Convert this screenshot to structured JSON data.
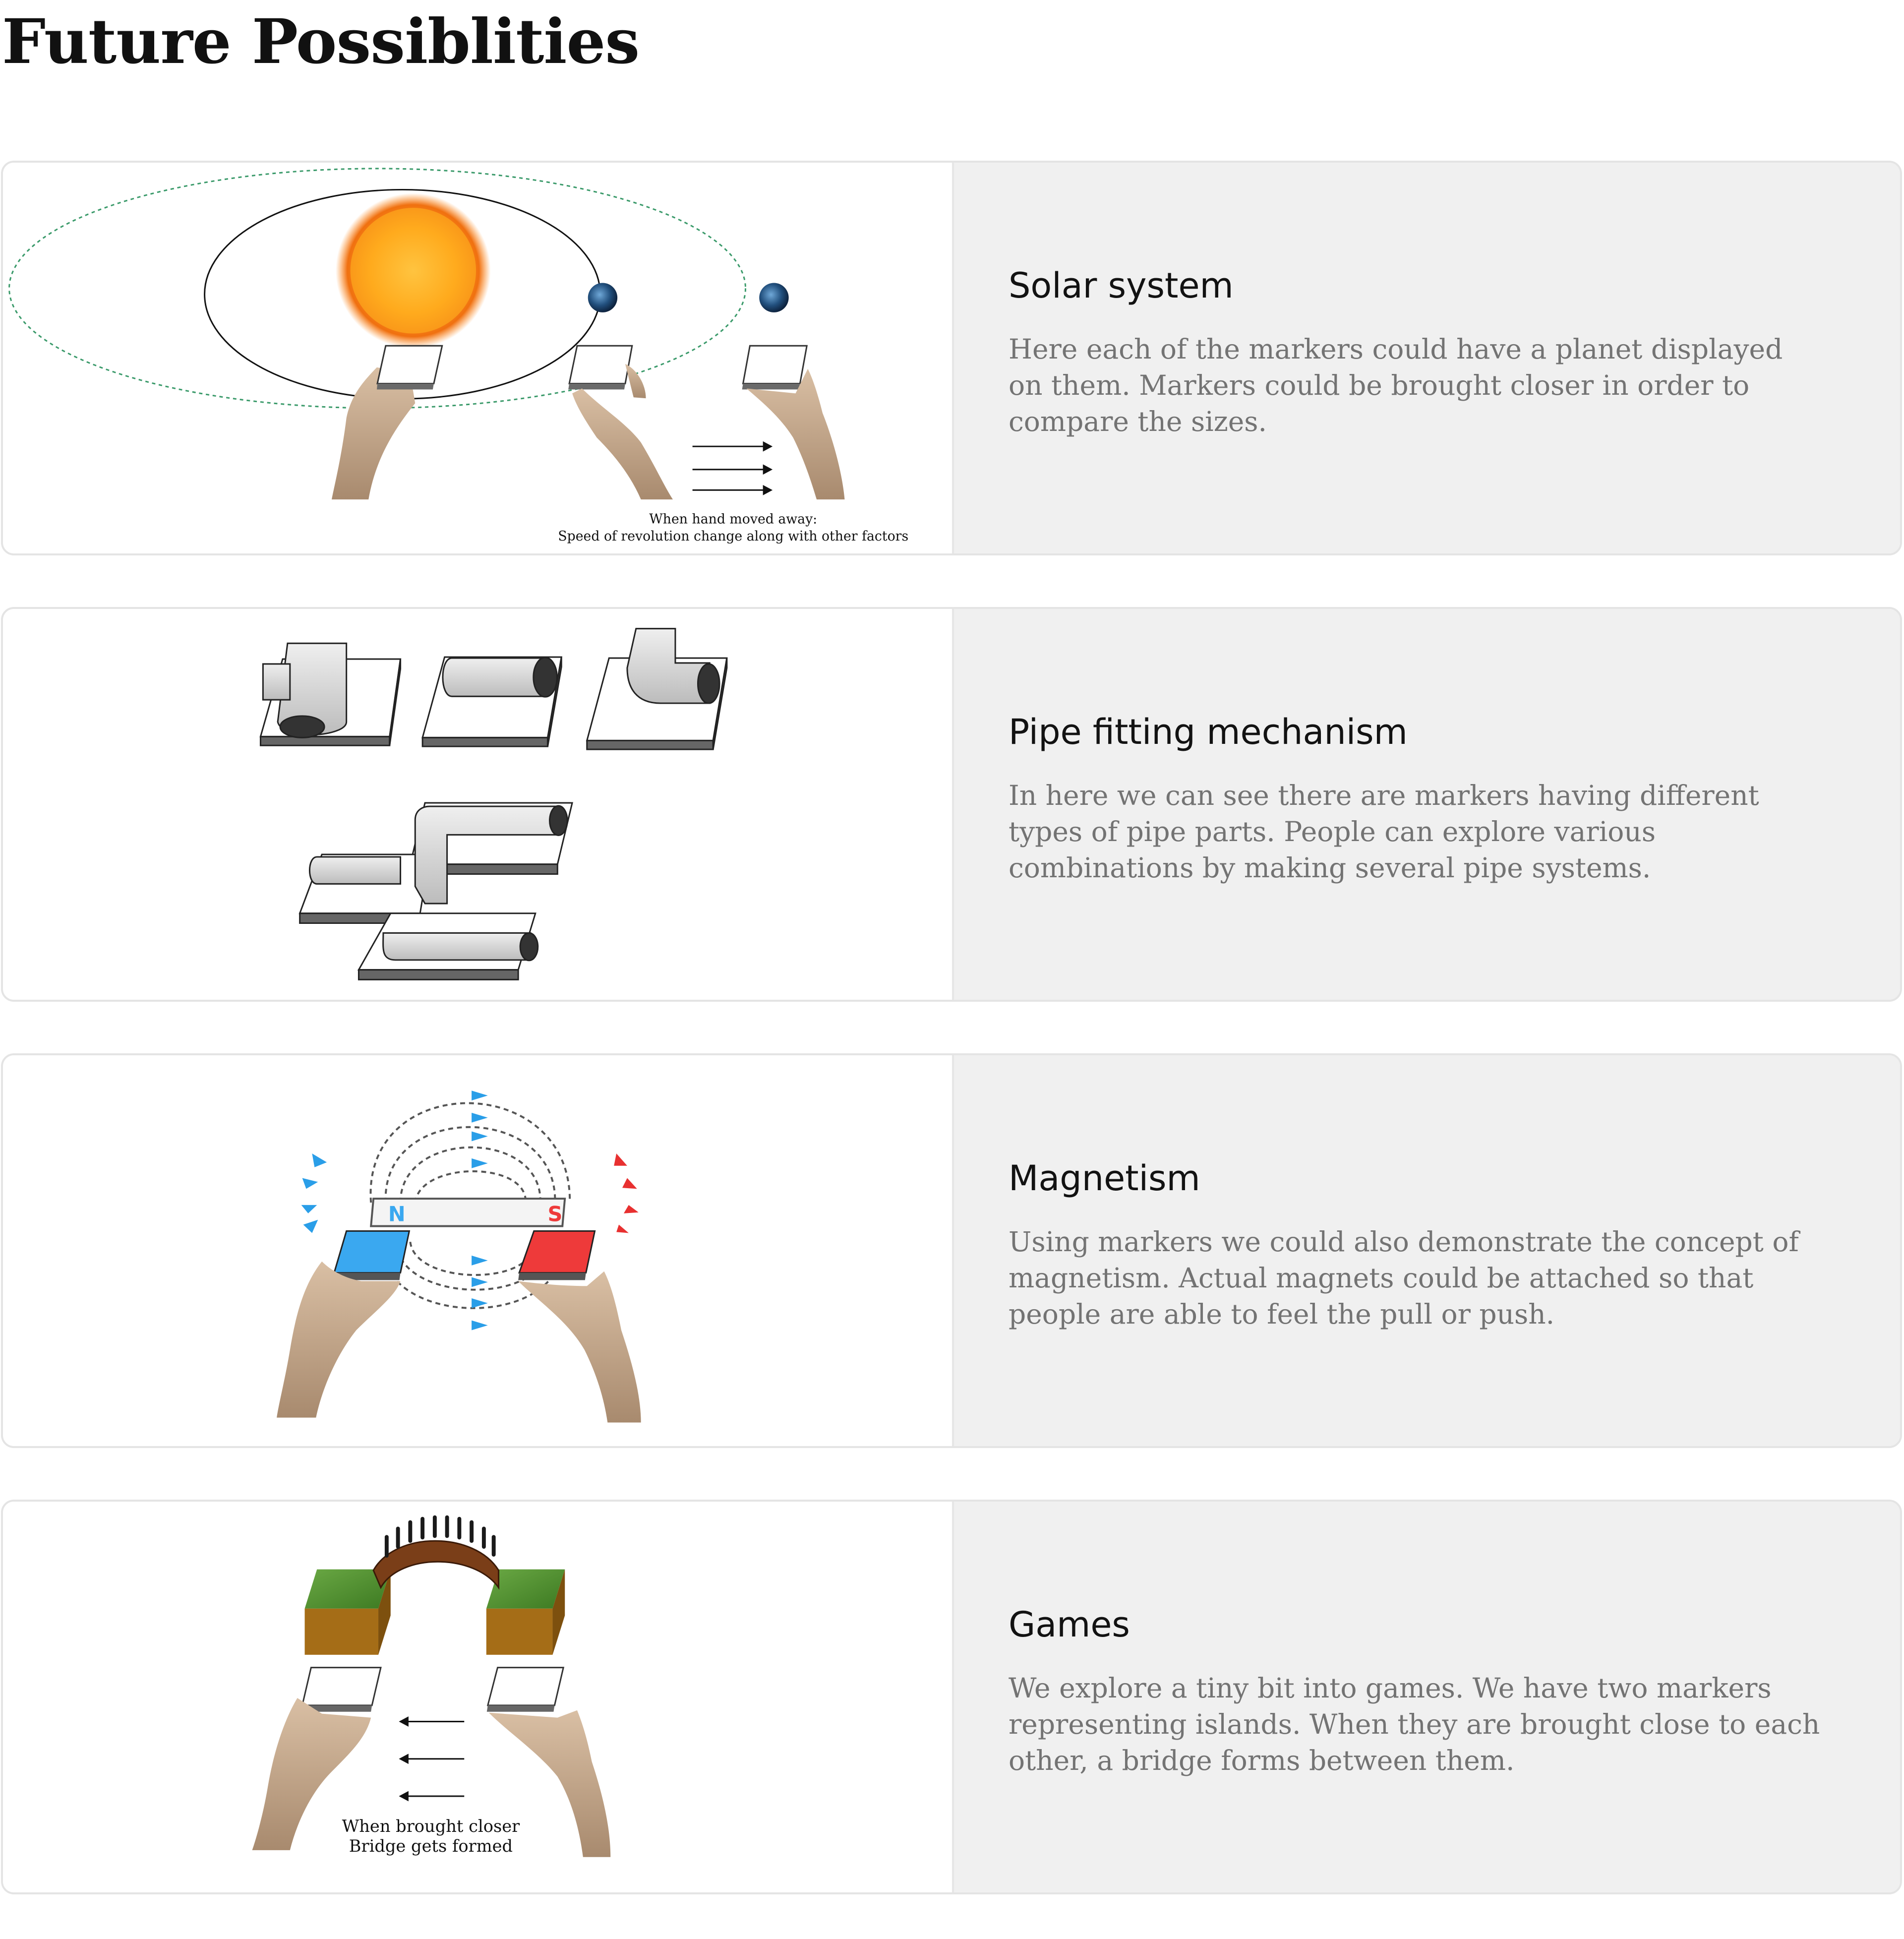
{
  "page_title": "Future Possiblities",
  "cards": [
    {
      "heading": "Solar system",
      "description": "Here each of the markers could have a planet displayed on them. Markers could be brought closer in order to compare the sizes.",
      "caption_line1": "When hand moved away:",
      "caption_line2": "Speed of revolution change along with other factors"
    },
    {
      "heading": "Pipe fitting mechanism",
      "description": "In here we can see there are markers having different types of pipe parts. People can explore various combinations by making several pipe systems."
    },
    {
      "heading": "Magnetism",
      "description": "Using markers we could also demonstrate the concept of magnetism. Actual magnets could be attached so that people are able to feel the pull or push.",
      "pole_north": "N",
      "pole_south": "S"
    },
    {
      "heading": "Games",
      "description": "We explore a tiny bit into games. We have two markers representing islands. When they are brought close to each other, a bridge forms between them.",
      "caption_line1": "When brought closer",
      "caption_line2": "Bridge gets formed"
    }
  ],
  "colors": {
    "text_panel_bg": "#f0f0f0",
    "heading": "#121212",
    "description": "#737373",
    "north_pole": "#3aa8f0",
    "south_pole": "#ee3a3a"
  }
}
